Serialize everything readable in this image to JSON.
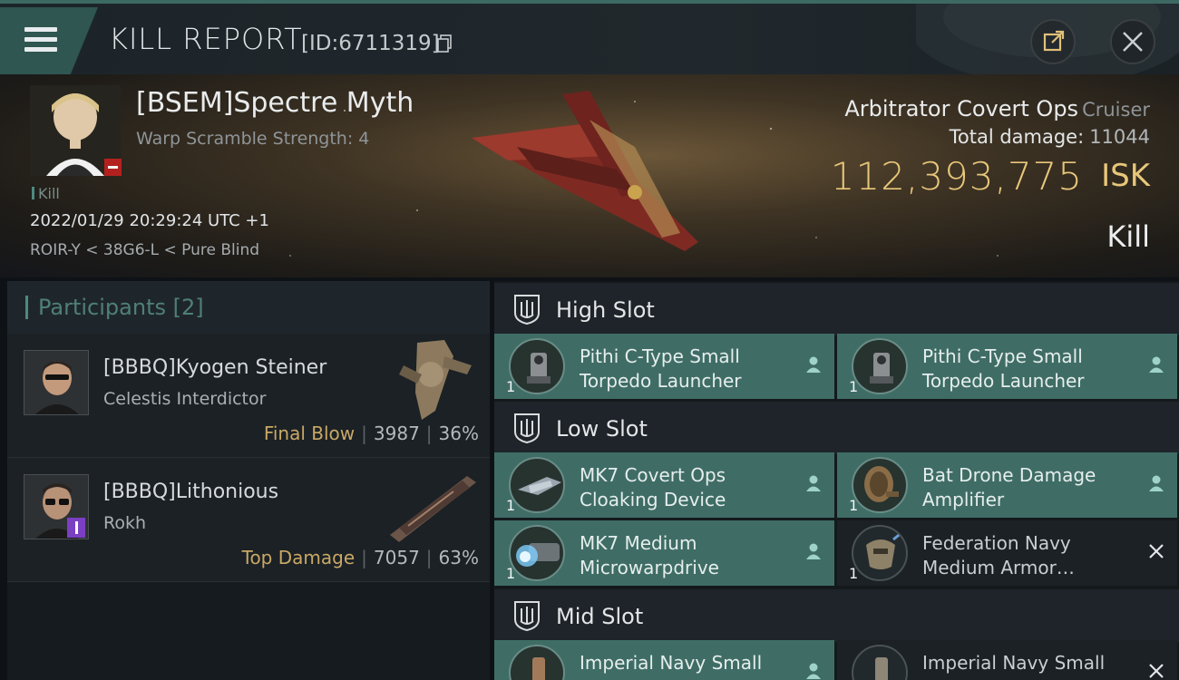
{
  "header": {
    "title": "KILL REPORT",
    "report_id": "[ID:6711319]"
  },
  "victim": {
    "name": "[BSEM]Spectre Myth",
    "warp_scramble": "Warp Scramble Strength: 4",
    "kill_tag": "Kill",
    "datetime": "2022/01/29 20:29:24 UTC +1",
    "location": "ROIR-Y < 38G6-L < Pure Blind",
    "ship_name": "Arbitrator Covert Ops",
    "ship_class": "Cruiser",
    "total_damage_label": "Total damage:",
    "total_damage": "11044",
    "isk_value": "112,393,775",
    "isk_unit": "ISK",
    "result": "Kill"
  },
  "participants": {
    "title": "Participants [2]",
    "rows": [
      {
        "name": "[BBBQ]Kyogen Steiner",
        "ship": "Celestis Interdictor",
        "tag": "Final Blow",
        "damage": "3987",
        "percent": "36%"
      },
      {
        "name": "[BBBQ]Lithonious",
        "ship": "Rokh",
        "tag": "Top Damage",
        "damage": "7057",
        "percent": "63%"
      }
    ]
  },
  "fitting": {
    "high_slot": "High Slot",
    "low_slot": "Low Slot",
    "mid_slot": "Mid Slot",
    "high_items": [
      {
        "name": "Pithi C-Type Small Torpedo Launcher",
        "qty": "1",
        "status": "dropped"
      },
      {
        "name": "Pithi C-Type Small Torpedo Launcher",
        "qty": "1",
        "status": "dropped"
      }
    ],
    "low_items": [
      {
        "name": "MK7 Covert Ops Cloaking Device",
        "qty": "1",
        "status": "dropped"
      },
      {
        "name": "Bat Drone Damage Amplifier",
        "qty": "1",
        "status": "dropped"
      },
      {
        "name": "MK7 Medium Microwarpdrive",
        "qty": "1",
        "status": "dropped"
      },
      {
        "name": "Federation Navy Medium Armor…",
        "qty": "1",
        "status": "destroyed"
      }
    ],
    "mid_items": [
      {
        "name": "Imperial Navy Small",
        "qty": "1",
        "status": "dropped"
      },
      {
        "name": "Imperial Navy Small",
        "qty": "1",
        "status": "destroyed"
      }
    ]
  },
  "colors": {
    "accent": "#3f6d66",
    "isk": "#e8c77a",
    "tag": "#c9a866"
  },
  "icons": {
    "menu": "hamburger-icon",
    "share": "share-icon",
    "close": "close-icon",
    "copy": "copy-icon",
    "pilot": "pilot-icon",
    "destroyed": "x-icon"
  }
}
